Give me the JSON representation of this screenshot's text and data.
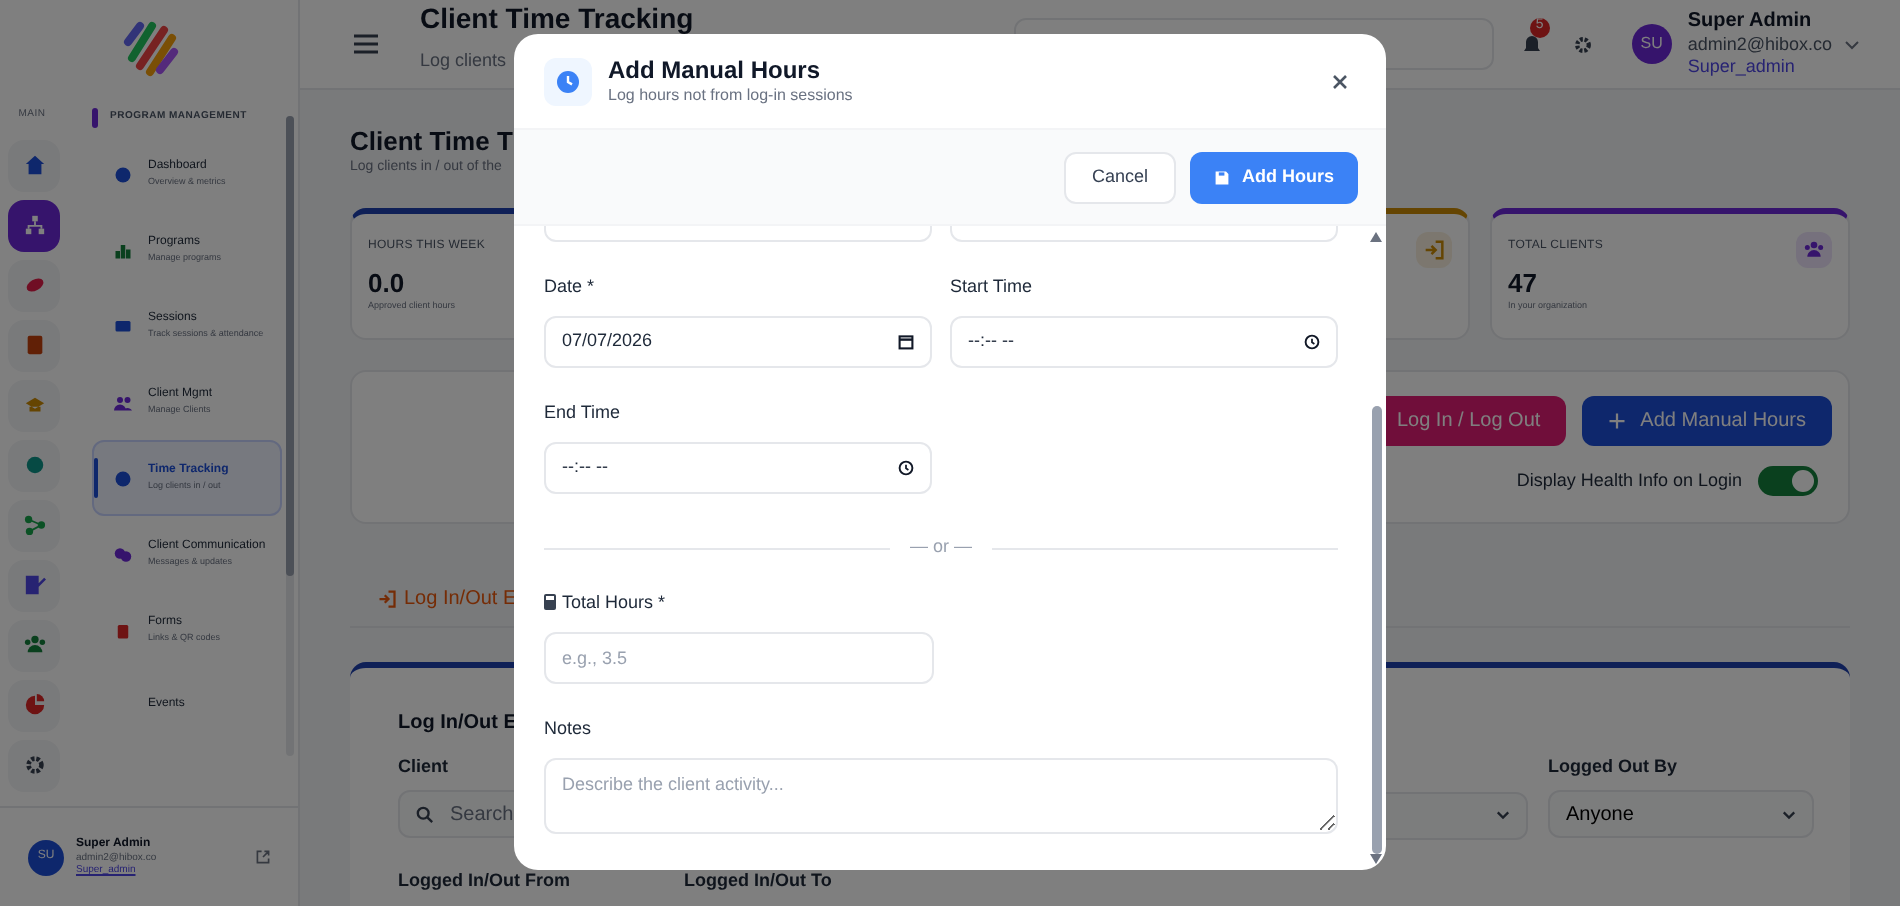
{
  "rail": {
    "label": "MAIN",
    "items": [
      {
        "selected": false
      },
      {
        "selected": true
      },
      {
        "selected": false
      },
      {
        "selected": false
      },
      {
        "selected": false
      },
      {
        "selected": false
      },
      {
        "selected": false
      },
      {
        "selected": false
      },
      {
        "selected": false
      },
      {
        "selected": false
      },
      {
        "selected": false
      }
    ]
  },
  "sidebar": {
    "section": "PROGRAM MANAGEMENT",
    "items": [
      {
        "title": "Dashboard",
        "subtitle": "Overview & metrics",
        "selected": false
      },
      {
        "title": "Programs",
        "subtitle": "Manage programs",
        "selected": false
      },
      {
        "title": "Sessions",
        "subtitle": "Track sessions & attendance",
        "selected": false
      },
      {
        "title": "Client Mgmt",
        "subtitle": "Manage Clients",
        "selected": false
      },
      {
        "title": "Time Tracking",
        "subtitle": "Log clients in / out",
        "selected": true
      },
      {
        "title": "Client Communication",
        "subtitle": "Messages & updates",
        "selected": false
      },
      {
        "title": "Forms",
        "subtitle": "Links & QR codes",
        "selected": false
      },
      {
        "title": "Events",
        "selected": false
      }
    ],
    "user": {
      "initials": "SU",
      "name": "Super Admin",
      "email": "admin2@hibox.co",
      "role": "Super_admin"
    }
  },
  "header": {
    "title": "Client Time Tracking",
    "subtitle": "Log clients",
    "notifications": "5",
    "user": {
      "initials": "SU",
      "name": "Super Admin",
      "email": "admin2@hibox.co",
      "role": "Super_admin"
    }
  },
  "page": {
    "title": "Client Time T",
    "subtitle": "Log clients in / out of the"
  },
  "stat_cards": [
    {
      "kind": "full",
      "label": "HOURS THIS WEEK",
      "value": "0.0",
      "note": "Approved client hours"
    },
    {
      "kind": "icon_only"
    },
    {
      "kind": "full",
      "label": "TOTAL CLIENTS",
      "value": "47",
      "note": "In your organization"
    }
  ],
  "actions": {
    "buttons": [
      {
        "label": "Log In / Log Out",
        "kind": "login"
      },
      {
        "label": "Add Manual Hours",
        "kind": "add"
      }
    ],
    "toggle": {
      "label": "Display Health Info on Login",
      "on": true
    }
  },
  "tab": {
    "label": "Log In/Out E",
    "selected": true
  },
  "filters": {
    "title": "Log In/Out E",
    "fields": [
      {
        "kind": "search",
        "label": "Client",
        "placeholder": "Search"
      },
      {
        "kind": "select"
      },
      {
        "kind": "select",
        "label": "Logged Out By",
        "value": "Anyone"
      }
    ],
    "labels": [
      "Logged In/Out From",
      "Logged In/Out To"
    ]
  },
  "modal": {
    "title": "Add Manual Hours",
    "subtitle": "Log hours not from log-in sessions",
    "buttons": [
      {
        "label": "Cancel",
        "kind": "secondary"
      },
      {
        "label": "Add Hours",
        "kind": "primary"
      }
    ],
    "fields": [
      {
        "kind": "blank"
      },
      {
        "kind": "blank"
      },
      {
        "kind": "date",
        "label": "Date *",
        "value": "07/07/2026"
      },
      {
        "kind": "time",
        "label": "Start Time",
        "value": "--:-- --"
      },
      {
        "kind": "time",
        "label": "End Time",
        "value": "--:-- --"
      }
    ],
    "divider": "— or —",
    "total": {
      "label": "Total Hours *",
      "placeholder": "e.g., 3.5"
    },
    "notes": {
      "label": "Notes",
      "placeholder": "Describe the client activity..."
    }
  }
}
